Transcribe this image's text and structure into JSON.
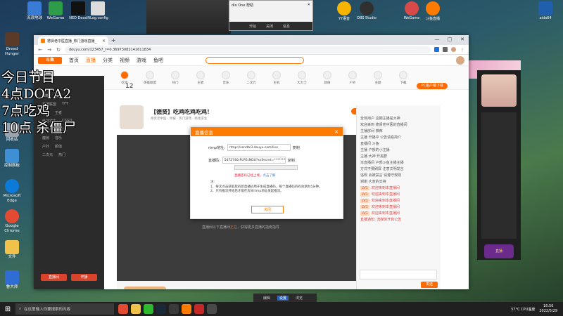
{
  "overlay": {
    "line1": "今日节目",
    "line2": "4点DOTA2",
    "line3": "7点吃鸡",
    "line4": "10点 杀僵尸"
  },
  "desktop_icons": [
    {
      "label": "流浪地球",
      "color": "#3a7bd5"
    },
    {
      "label": "WeGame",
      "color": "#2f9c4a"
    },
    {
      "label": "Dread Hunger",
      "color": "#5a3b2a"
    },
    {
      "label": "回收站",
      "color": "#9aa4b0"
    },
    {
      "label": "控制面板",
      "color": "#3e8fd4"
    },
    {
      "label": "Microsoft Edge",
      "color": "#0c7ad8"
    },
    {
      "label": "Google Chrome",
      "color": "#e24a33"
    },
    {
      "label": "文件",
      "color": "#f0c24c"
    },
    {
      "label": "鲁大师",
      "color": "#2f6dd4"
    }
  ],
  "top_apps": [
    {
      "label": "NLog.config",
      "color": "#dcdcdc"
    },
    {
      "label": "NED Dead",
      "color": "#111111"
    },
    {
      "label": "YY语音",
      "color": "#f4b400"
    },
    {
      "label": "OBS Studio",
      "color": "#303030"
    },
    {
      "label": "WeGame",
      "color": "#d84a4a"
    },
    {
      "label": "斗鱼直播",
      "color": "#ff7b00"
    },
    {
      "label": "aida64",
      "color": "#1f5fae"
    }
  ],
  "mini_window": {
    "title": "dio One  帮助",
    "tabs": [
      "开始",
      "关闭",
      "信息"
    ]
  },
  "browser": {
    "tab_title": "德贤老中医直播_热门游戏直播_",
    "url": "douyu.com/123457_r=0.36973082141611834",
    "controls": {
      "min": "—",
      "max": "□",
      "close": "✕"
    }
  },
  "douyu": {
    "logo": "斗鱼",
    "nav": [
      "首页",
      "直播",
      "分类",
      "视频",
      "游戏",
      "鱼吧"
    ],
    "category_count": "12",
    "categories": [
      "吃鸡",
      "英雄联盟",
      "热门",
      "王者",
      "音乐",
      "二次元",
      "主机",
      "大力士",
      "颜值",
      "户外",
      "主题",
      "下载"
    ],
    "pc_button": "PC客户端下载",
    "room_title": "【德贤】吃鸡吃鸡吃鸡！",
    "room_sub": "德贤老中医 · 举报 · 热门游戏 · 绝地求生",
    "follow": "关注",
    "player_msg_prefix": "直播间以下直播间",
    "player_msg_link": "正在",
    "player_msg_suffix": "，获得更多直播的指南指导",
    "left_menu": [
      {
        "a": "推荐",
        "b": "频道"
      },
      {
        "a": "英雄联盟",
        "b": "TFT"
      },
      {
        "a": "吃鸡",
        "b": "王者"
      },
      {
        "a": "绝地求生",
        "b": "CSGO"
      },
      {
        "a": "DOTA2",
        "b": "单机"
      },
      {
        "a": "魔兽",
        "b": "音乐"
      },
      {
        "a": "户外",
        "b": "颜值"
      },
      {
        "a": "二次元",
        "b": "热门"
      }
    ],
    "left_buttons": [
      "直播间",
      "开播"
    ]
  },
  "chat": {
    "lines": [
      {
        "tag": "",
        "text": "全体用户 这期主播是大神"
      },
      {
        "tag": "",
        "text": "欢迎来到 德贤老中医的直播间"
      },
      {
        "tag": "",
        "text": "主播房间 推荐"
      },
      {
        "tag": "",
        "text": "主播 开播中 公告请看简介"
      },
      {
        "tag": "",
        "text": "直播间 斗鱼"
      },
      {
        "tag": "",
        "text": "主播 户部的小主播"
      },
      {
        "tag": "",
        "text": "主播 大神 开黑群"
      },
      {
        "tag": "",
        "text": "本直播间 户部斗鱼主播主播"
      },
      {
        "tag": "",
        "text": "方式不要刷屏 注意文明发言"
      },
      {
        "tag": "",
        "text": "违规 会被禁言 请遵守规则"
      },
      {
        "tag": "",
        "text": "谢谢 大家的支持"
      },
      {
        "tag": "LV1",
        "text": "欢迎来到本直播间"
      },
      {
        "tag": "LV1",
        "text": "欢迎来到本直播间"
      },
      {
        "tag": "LV1",
        "text": "欢迎来到本直播间"
      },
      {
        "tag": "LV1",
        "text": "欢迎来到本直播间"
      },
      {
        "tag": "LV1",
        "text": "欢迎来到本直播间"
      },
      {
        "tag": "",
        "text": "直播通知: 流媒体开启公告"
      }
    ],
    "send": "发送"
  },
  "modal": {
    "title": "直播信息",
    "close": "✕",
    "rtmp_label": "rtmp地址:",
    "rtmp_value": "rtmp://sendtc3.douyu.com/live",
    "key_label": "直播码:",
    "key_value": "5472746rPcPEcNDU?xsSecret=*************",
    "copy": "复制",
    "warning": "直播密码已经上线",
    "warning_link": "点击了解",
    "notes": [
      "注:",
      "1、每次点击获取后的新直播码用于生成直播码，每个直播码的有效期为5分钟。",
      "2、只有推流开始后才能在房间rtmp地址发起推流。"
    ],
    "ok": "关闭"
  },
  "obs_strip": [
    "编辑",
    "设置",
    "浏览"
  ],
  "taskbar": {
    "search_placeholder": "在这里输入你要搜索的内容",
    "cpu": "57°C CPU温度",
    "time": "16:50",
    "date": "2022/5/29"
  },
  "side_window": {
    "badge": "直播"
  }
}
